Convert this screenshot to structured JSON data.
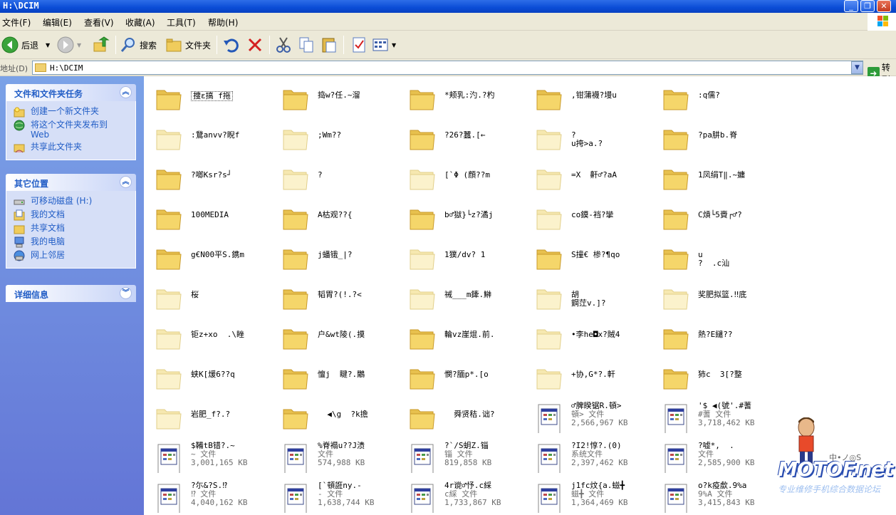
{
  "window": {
    "title": "H:\\DCIM"
  },
  "menu": [
    "文件(F)",
    "编辑(E)",
    "查看(V)",
    "收藏(A)",
    "工具(T)",
    "帮助(H)"
  ],
  "toolbar": {
    "back": "后退",
    "search": "搜索",
    "folders": "文件夹"
  },
  "address": {
    "label": "地址(D)",
    "path": "H:\\DCIM",
    "go": "转到"
  },
  "tasks_panel": {
    "title": "文件和文件夹任务",
    "items": [
      "创建一个新文件夹",
      "将这个文件夹发布到\nWeb",
      "共享此文件夹"
    ]
  },
  "places_panel": {
    "title": "其它位置",
    "items": [
      "可移动磁盘 (H:)",
      "我的文档",
      "共享文档",
      "我的电脑",
      "网上邻居"
    ]
  },
  "details_panel": {
    "title": "详细信息"
  },
  "items": [
    {
      "name": "捜ε搞 f拖"
    },
    {
      "name": "捣w?任.~溜"
    },
    {
      "name": "*颊乳:汋.?杓"
    },
    {
      "name": ",钳蒲襪?墁u"
    },
    {
      "name": ":q儒?"
    },
    {
      "name": ":鵞anvv?睨f",
      "faded": true
    },
    {
      "name": ";Wm??",
      "faded": true
    },
    {
      "name": "?26?蠶.[←"
    },
    {
      "name": "?\nu挎>a.?",
      "faded": true
    },
    {
      "name": "?pa肼b.脊"
    },
    {
      "name": "?啷Ksr?s┘"
    },
    {
      "name": "?",
      "faded": true
    },
    {
      "name": "[`Φ (顔??m",
      "faded": true
    },
    {
      "name": "=X  鼾♂?aA",
      "faded": true
    },
    {
      "name": "1凤绢T‖.~嫞"
    },
    {
      "name": "100MEDIA"
    },
    {
      "name": "A枯观??{"
    },
    {
      "name": "b♂獄}└z?潏j"
    },
    {
      "name": "co鏌-裆?攣",
      "faded": true
    },
    {
      "name": "C熕└5賫┌♂?"
    },
    {
      "name": "g€N00平S.鎸m"
    },
    {
      "name": "j蟠锇_|?"
    },
    {
      "name": "1獛/dv? 1",
      "faded": true
    },
    {
      "name": "S撞€ 椮?¶qo"
    },
    {
      "name": "u\n?  .c汕"
    },
    {
      "name": "桜",
      "faded": true
    },
    {
      "name": "韬胃?(!.?<"
    },
    {
      "name": "祴___m鏲.鰰",
      "faded": true
    },
    {
      "name": "胡\n鋼茳v.]?",
      "faded": true
    },
    {
      "name": "奖肥拟篮.‼底",
      "faded": true
    },
    {
      "name": "钜z+xo  .\\睉",
      "faded": true
    },
    {
      "name": "户&wt陵(.摸"
    },
    {
      "name": "輪vz崖焜.前."
    },
    {
      "name": "•李he◘x?賊4",
      "faded": true
    },
    {
      "name": "熱?E繾??"
    },
    {
      "name": "蛱K[煖6??q",
      "faded": true
    },
    {
      "name": "憻j  睷?.鷴"
    },
    {
      "name": "憫?腼p*.[o"
    },
    {
      "name": "+协,G*?.軒",
      "faded": true
    },
    {
      "name": "犻c  3[?整"
    },
    {
      "name": "岩肥_f?.?",
      "faded": true
    },
    {
      "name": "  ◀\\g  ?k擔"
    },
    {
      "name": "  舜贤秸.诎?"
    },
    {
      "name": "♂脾睽锯R.頓>",
      "file": true,
      "type": "頓> 文件",
      "size": "2,566,967 KB"
    },
    {
      "name": "'$ ◀(號'.#蓍",
      "file": true,
      "type": "#蓍 文件",
      "size": "3,718,462 KB"
    },
    {
      "name": "$鞴tB错?.~",
      "file": true,
      "type": "~ 文件",
      "size": "3,001,165 KB"
    },
    {
      "name": "%脊褟u??J渍",
      "file": true,
      "type": "文件",
      "size": "574,988 KB"
    },
    {
      "name": "?`/S蚏Z.锱",
      "file": true,
      "type": "锱 文件",
      "size": "819,858 KB"
    },
    {
      "name": "?I2!惇?.(0)",
      "file": true,
      "type": "系统文件",
      "size": "2,397,462 KB"
    },
    {
      "name": "?嘘*,  .",
      "file": true,
      "type": "文件",
      "size": "2,585,900 KB"
    },
    {
      "name": "?尓&?S.⁉",
      "file": true,
      "type": "⁉ 文件",
      "size": "4,040,162 KB"
    },
    {
      "name": "[`頓誑ny.-",
      "file": true,
      "type": "- 文件",
      "size": "1,638,744 KB"
    },
    {
      "name": "4r谠♂忬.c綵",
      "file": true,
      "type": "c綵 文件",
      "size": "1,733,867 KB"
    },
    {
      "name": "j1fc炆{a.螆╋",
      "file": true,
      "type": "螆╋ 文件",
      "size": "1,364,469 KB"
    },
    {
      "name": "o?k疫歔.9%a",
      "file": true,
      "type": "9%A 文件",
      "size": "3,415,843 KB"
    }
  ],
  "watermark": {
    "text": "MOTOF.net",
    "sub": "专业维修手机综合数据论坛",
    "corner": "中•ノ◎S"
  }
}
